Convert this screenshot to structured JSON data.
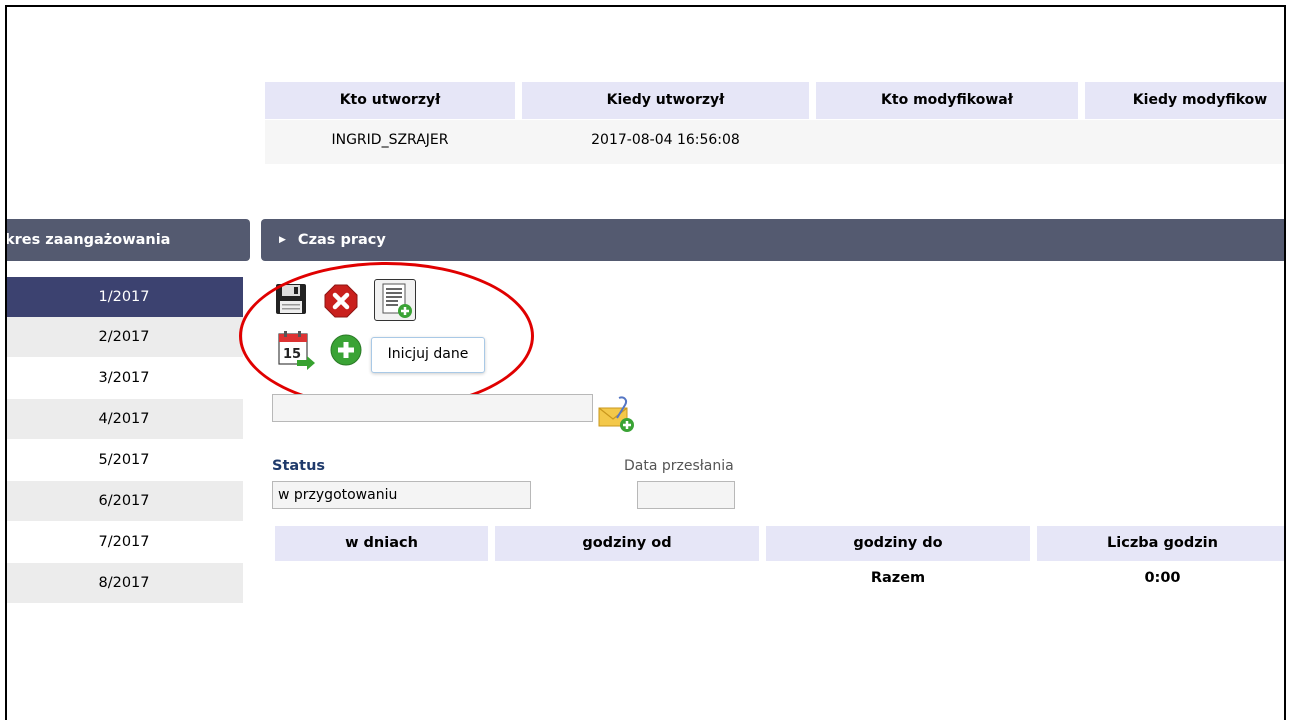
{
  "audit": {
    "headers": [
      "Kto utworzył",
      "Kiedy utworzył",
      "Kto modyfikował",
      "Kiedy modyfikow"
    ],
    "row": [
      "INGRID_SZRAJER",
      "2017-08-04 16:56:08",
      "",
      ""
    ]
  },
  "left_panel": {
    "header": "kres zaangażowania",
    "items": [
      "1/2017",
      "2/2017",
      "3/2017",
      "4/2017",
      "5/2017",
      "6/2017",
      "7/2017",
      "8/2017"
    ],
    "selected": "1/2017"
  },
  "right_panel": {
    "header": "Czas pracy",
    "toolbar": {
      "icons": [
        "floppy-save-icon",
        "red-delete-icon",
        "document-add-icon",
        "calendar-import-icon",
        "green-plus-icon"
      ],
      "tooltip": "Inicjuj dane"
    },
    "attachment_input": {
      "value": "",
      "icon": "envelope-attach-icon"
    },
    "status_label": "Status",
    "status_value": "w przygotowaniu",
    "date_label": "Data przesłania",
    "date_value": "",
    "hours_table": {
      "headers": [
        "w dniach",
        "godziny od",
        "godziny do",
        "Liczba godzin"
      ],
      "total_label": "Razem",
      "total_value": "0:00"
    }
  },
  "colors": {
    "panel_header": "#545a70",
    "selected_item": "#3c4270",
    "table_header": "#e6e6f7",
    "annotation": "#e00000"
  }
}
